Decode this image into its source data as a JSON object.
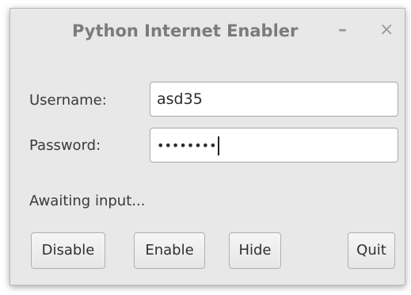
{
  "window": {
    "title": "Python Internet Enabler",
    "minimize_glyph": "–",
    "close_glyph": "×"
  },
  "form": {
    "username_label": "Username:",
    "username_value": "asd35",
    "password_label": "Password:",
    "password_masked": "••••••••"
  },
  "status": {
    "text": "Awaiting input..."
  },
  "buttons": {
    "disable": "Disable",
    "enable": "Enable",
    "hide": "Hide",
    "quit": "Quit"
  }
}
